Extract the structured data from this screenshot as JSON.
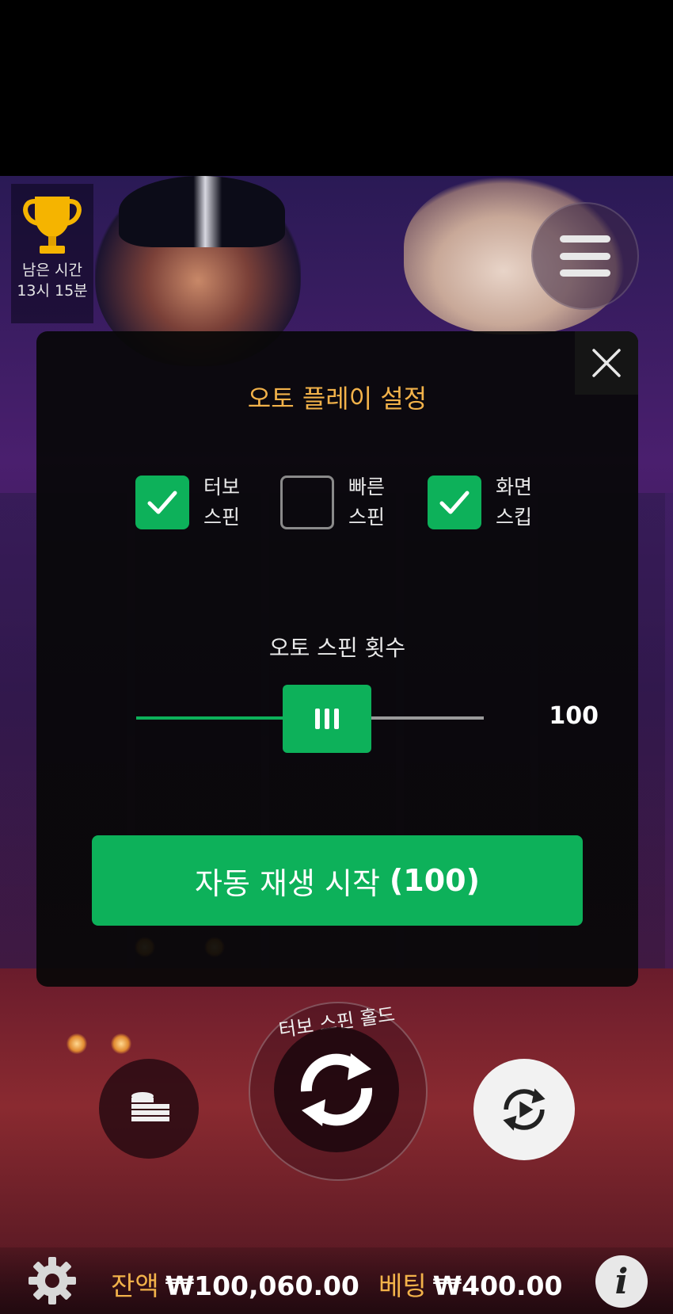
{
  "tournament": {
    "label": "남은 시간",
    "time": "13시 15분"
  },
  "modal": {
    "title": "오토 플레이 설정",
    "options": [
      {
        "line1": "터보",
        "line2": "스핀",
        "checked": true
      },
      {
        "line1": "빠른",
        "line2": "스핀",
        "checked": false
      },
      {
        "line1": "화면",
        "line2": "스킵",
        "checked": true
      }
    ],
    "spin_count_title": "오토 스핀 횟수",
    "slider": {
      "value": "100",
      "fill_fraction": 0.55
    },
    "start_button": {
      "text": "자동 재생 시작",
      "count": "(100)"
    }
  },
  "controls": {
    "turbo_label": "터보 스핀 홀드"
  },
  "status": {
    "balance_label": "잔액",
    "balance_value": "₩100,060.00",
    "bet_label": "베팅",
    "bet_value": "₩400.00"
  },
  "info_label": "i",
  "colors": {
    "accent_green": "#0db15a",
    "label_gold": "#f2b24a"
  }
}
